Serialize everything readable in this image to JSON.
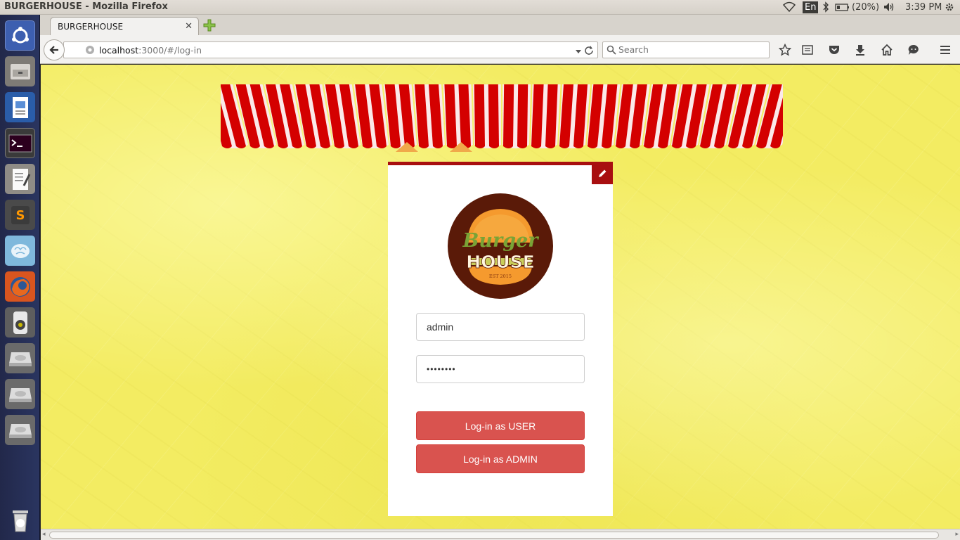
{
  "system_bar": {
    "window_title": "BURGERHOUSE - Mozilla Firefox",
    "language": "En",
    "battery": "(20%)",
    "clock": "3:39 PM"
  },
  "launcher": {
    "items": [
      "ubuntu-dash-icon",
      "file-manager-icon",
      "writer-icon",
      "terminal-icon",
      "text-editor-icon",
      "sublime-text-icon",
      "brain-app-icon",
      "firefox-icon",
      "speaker-app-icon",
      "drive-icon",
      "drive-icon",
      "drive-icon",
      "trash-icon"
    ]
  },
  "browser": {
    "tab_title": "BURGERHOUSE",
    "url_host": "localhost",
    "url_rest": ":3000/#/log-in",
    "search_placeholder": "Search"
  },
  "login": {
    "logo_word1": "Burger",
    "logo_word2": "HOUSE",
    "logo_est": "EST 2015",
    "username_value": "admin",
    "password_value": "••••••••",
    "user_button": "Log-in as USER",
    "admin_button": "Log-in as ADMIN"
  },
  "colors": {
    "page_background": "#f3ec62",
    "awning_red": "#d40000",
    "card_accent": "#a80f10",
    "button": "#d9534f",
    "logo_brown": "#5a1a08"
  }
}
